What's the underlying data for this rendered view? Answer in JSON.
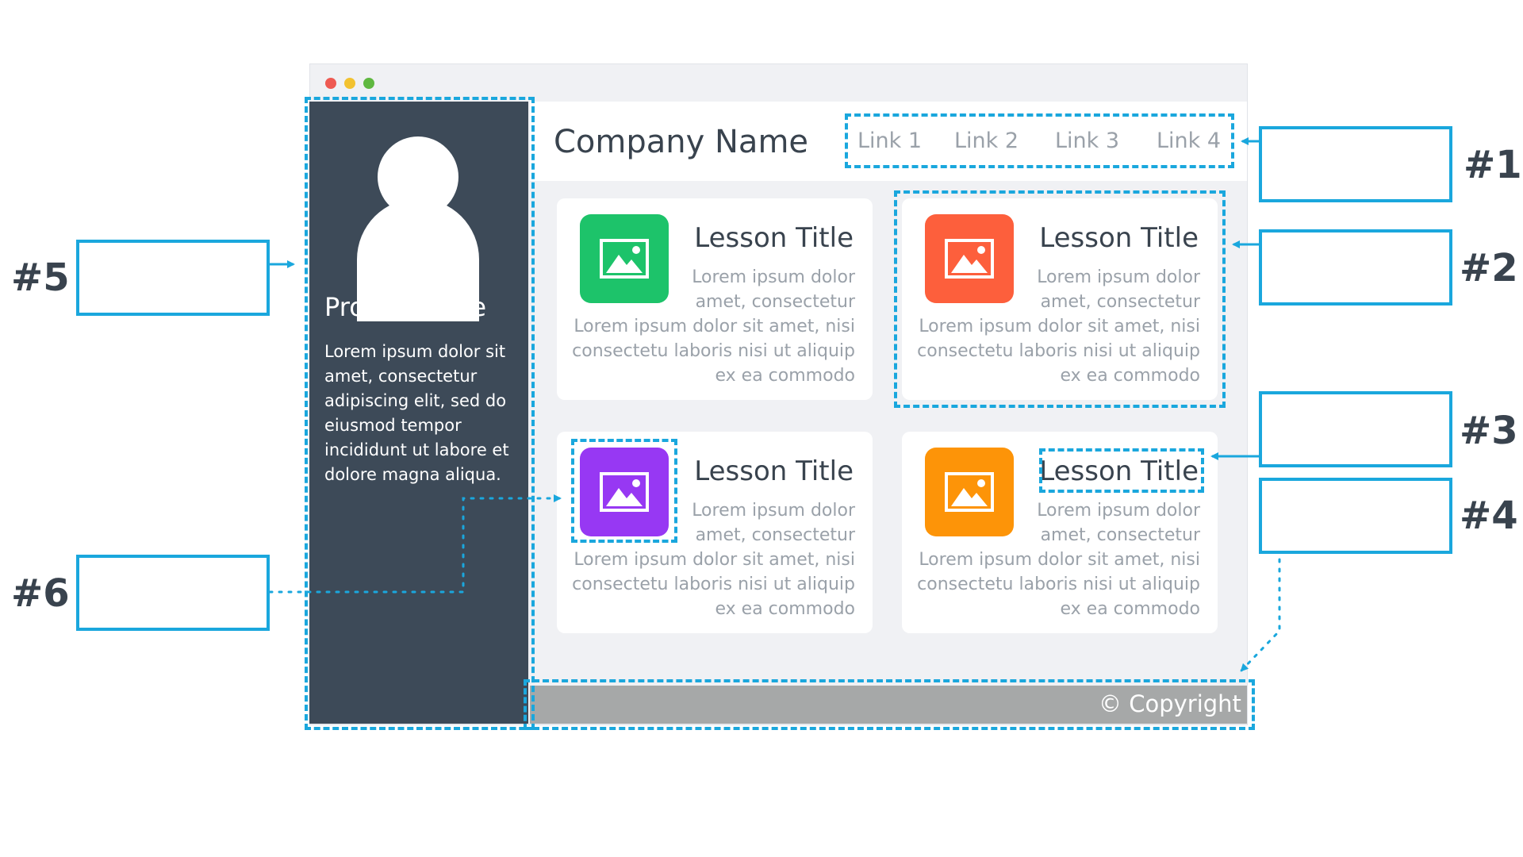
{
  "window": {
    "traffic_lights": [
      "#ee5a52",
      "#f2c230",
      "#5fb840"
    ]
  },
  "sidebar": {
    "avatar_icon": "user-icon",
    "profile_name": "Profile Name",
    "bio": "Lorem ipsum dolor sit amet, consectetur adipiscing elit, sed do eiusmod tempor incididunt ut labore et dolore magna aliqua."
  },
  "header": {
    "company_name": "Company Name",
    "links": [
      "Link 1",
      "Link 2",
      "Link 3",
      "Link 4"
    ]
  },
  "cards": [
    {
      "title": "Lesson Title",
      "excerpt": "Lorem ipsum dolor amet, consectetur",
      "body": "Lorem ipsum dolor sit amet, nisi consectetu laboris nisi ut aliquip ex ea commodo",
      "icon": "image-icon",
      "color": "#1dc36a"
    },
    {
      "title": "Lesson Title",
      "excerpt": "Lorem ipsum dolor amet, consectetur",
      "body": "Lorem ipsum dolor sit amet, nisi consectetu laboris nisi ut aliquip ex ea commodo",
      "icon": "image-icon",
      "color": "#fd5f3c"
    },
    {
      "title": "Lesson Title",
      "excerpt": "Lorem ipsum dolor amet, consectetur",
      "body": "Lorem ipsum dolor sit amet, nisi consectetu laboris nisi ut aliquip ex ea commodo",
      "icon": "image-icon",
      "color": "#9738f3"
    },
    {
      "title": "Lesson Title",
      "excerpt": "Lorem ipsum dolor amet, consectetur",
      "body": "Lorem ipsum dolor sit amet, nisi consectetu laboris nisi ut aliquip ex ea commodo",
      "icon": "image-icon",
      "color": "#fd9408"
    }
  ],
  "footer": {
    "copyright": "© Copyright"
  },
  "annotations": {
    "accent_color": "#1aa7dd",
    "tags": [
      "#1",
      "#2",
      "#3",
      "#4",
      "#5",
      "#6"
    ]
  }
}
